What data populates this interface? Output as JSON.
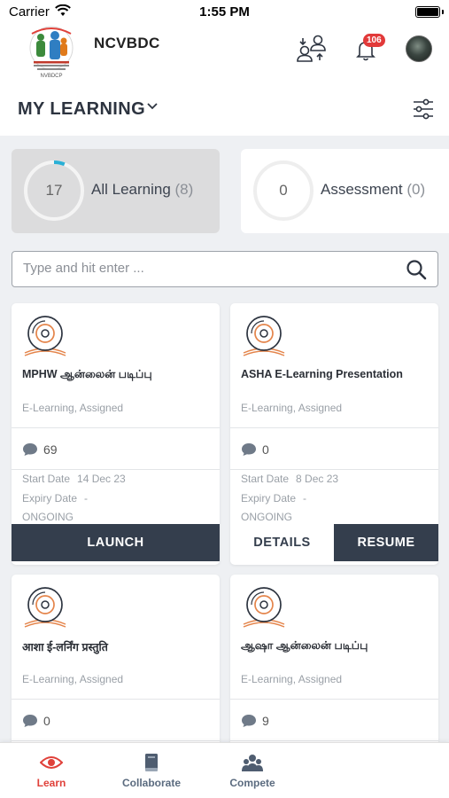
{
  "status_bar": {
    "carrier": "Carrier",
    "time": "1:55 PM"
  },
  "header": {
    "app_name": "NCVBDC",
    "notification_count": "106",
    "logo_caption": "NVBDCP"
  },
  "section": {
    "title": "MY LEARNING"
  },
  "stats": [
    {
      "count": "17",
      "label": "All Learning",
      "total": "(8)",
      "progress_fraction": 0.06,
      "selected": true
    },
    {
      "count": "0",
      "label": "Assessment",
      "total": "(0)",
      "progress_fraction": 0,
      "selected": false
    }
  ],
  "search": {
    "placeholder": "Type and hit enter ..."
  },
  "labels": {
    "start_date": "Start Date",
    "expiry_date": "Expiry Date"
  },
  "cards": [
    {
      "title": "MPHW ஆன்லைன் படிப்பு",
      "tags": "E-Learning, Assigned",
      "comments": "69",
      "start_date": "14 Dec 23",
      "expiry_date": "-",
      "status": "ONGOING",
      "buttons": [
        "LAUNCH"
      ]
    },
    {
      "title": "ASHA E-Learning Presentation",
      "tags": "E-Learning, Assigned",
      "comments": "0",
      "start_date": "8 Dec 23",
      "expiry_date": "-",
      "status": "ONGOING",
      "buttons": [
        "DETAILS",
        "RESUME"
      ]
    },
    {
      "title": "आशा ई-लर्निंग प्रस्तुति",
      "tags": "E-Learning, Assigned",
      "comments": "0"
    },
    {
      "title": "ஆஷா ஆன்லைன் படிப்பு",
      "tags": "E-Learning, Assigned",
      "comments": "9"
    }
  ],
  "bottom_nav": [
    {
      "label": "Learn",
      "icon": "eye-icon",
      "active": true
    },
    {
      "label": "Collaborate",
      "icon": "book-icon",
      "active": false
    },
    {
      "label": "Compete",
      "icon": "group-icon",
      "active": false
    }
  ],
  "colors": {
    "accent": "#e0413a",
    "dark_button": "#343e4d",
    "progress": "#2ab0d6",
    "nav_inactive": "#5b6b7f"
  }
}
